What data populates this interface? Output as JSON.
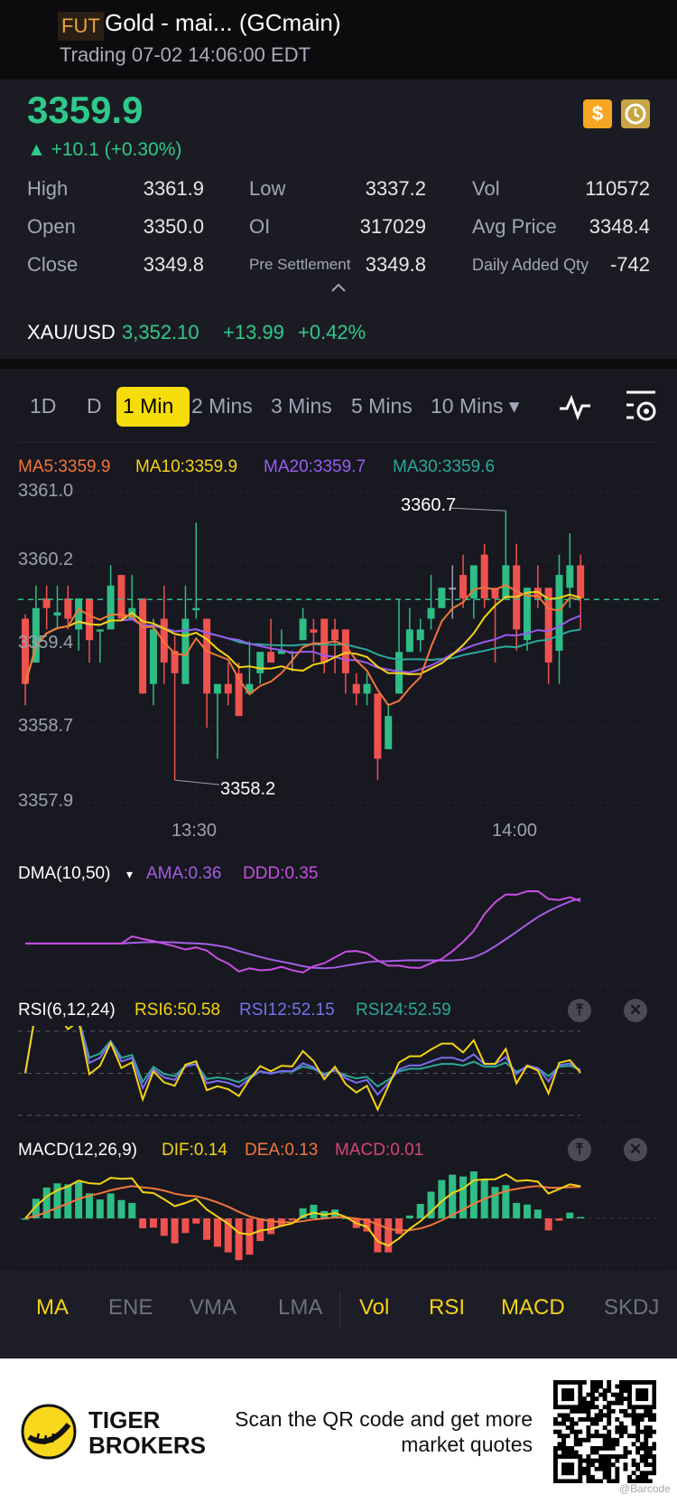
{
  "header": {
    "badge": "FUT",
    "title": "Gold - mai... (GCmain)",
    "status": "Trading 07-02 14:06:00 EDT"
  },
  "quote": {
    "last": "3359.9",
    "change": "▲ +10.1 (+0.30%)",
    "icons": [
      "dollar-icon",
      "history-clock-icon"
    ],
    "stats": [
      {
        "label": "High",
        "value": "3361.9"
      },
      {
        "label": "Low",
        "value": "3337.2"
      },
      {
        "label": "Vol",
        "value": "110572"
      },
      {
        "label": "Open",
        "value": "3350.0"
      },
      {
        "label": "OI",
        "value": "317029"
      },
      {
        "label": "Avg Price",
        "value": "3348.4"
      },
      {
        "label": "Close",
        "value": "3349.8"
      },
      {
        "label": "Pre Settlement",
        "value": "3349.8"
      },
      {
        "label": "Daily Added Qty",
        "value": "-742"
      }
    ],
    "related": {
      "symbol": "XAU/USD",
      "price": "3,352.10",
      "change": "+13.99",
      "pct": "+0.42%"
    }
  },
  "tabs": {
    "items": [
      "1D",
      "D",
      "1 Min",
      "2 Mins",
      "3 Mins",
      "5 Mins",
      "10 Mins ▾"
    ],
    "active": "1 Min"
  },
  "colors": {
    "up": "#2ebd85",
    "down": "#f0524f",
    "accent": "#f5dc0b",
    "ma5": "#f2763a",
    "ma10": "#f5d214",
    "ma20": "#9a5cf0",
    "ma30": "#2aa99a"
  },
  "legend": {
    "ma5": "MA5:3359.9",
    "ma10": "MA10:3359.9",
    "ma20": "MA20:3359.7",
    "ma30": "MA30:3359.6",
    "dma": "DMA(10,50)",
    "dma_caret": "▾",
    "ama": "AMA:0.36",
    "ddd": "DDD:0.35",
    "rsi": "RSI(6,12,24)",
    "rsi6": "RSI6:50.58",
    "rsi12": "RSI12:52.15",
    "rsi24": "RSI24:52.59",
    "macd": "MACD(12,26,9)",
    "dif": "DIF:0.14",
    "dea": "DEA:0.13",
    "macdv": "MACD:0.01"
  },
  "chart_data": {
    "type": "candlestick",
    "y_tick_labels": [
      "3361.0",
      "3360.2",
      "3359.4",
      "3358.7",
      "3357.9"
    ],
    "x_tick_labels": [
      "13:30",
      "14:00"
    ],
    "ylim": [
      3358.0,
      3360.9
    ],
    "high_label": "3360.7",
    "low_label": "3358.2",
    "last_price_line": 3359.9,
    "ohlc": [
      [
        3359.72,
        3359.76,
        3358.91,
        3359.11
      ],
      [
        3359.31,
        3360.03,
        3359.31,
        3359.82
      ],
      [
        3359.91,
        3360.03,
        3359.62,
        3359.82
      ],
      [
        3359.75,
        3360.03,
        3359.62,
        3359.78
      ],
      [
        3359.91,
        3360.03,
        3359.62,
        3359.72
      ],
      [
        3359.62,
        3359.91,
        3359.42,
        3359.91
      ],
      [
        3359.91,
        3359.91,
        3359.31,
        3359.52
      ],
      [
        3359.6,
        3359.62,
        3359.31,
        3359.62
      ],
      [
        3359.62,
        3360.22,
        3359.62,
        3360.03
      ],
      [
        3360.13,
        3360.13,
        3359.72,
        3359.72
      ],
      [
        3359.72,
        3360.13,
        3359.72,
        3359.82
      ],
      [
        3359.91,
        3359.91,
        3359.02,
        3359.02
      ],
      [
        3359.11,
        3359.72,
        3358.91,
        3359.62
      ],
      [
        3359.72,
        3360.03,
        3359.11,
        3359.31
      ],
      [
        3359.42,
        3359.56,
        3358.21,
        3359.21
      ],
      [
        3359.11,
        3360.03,
        3359.11,
        3359.72
      ],
      [
        3359.8,
        3360.62,
        3359.72,
        3359.82
      ],
      [
        3359.72,
        3359.72,
        3358.7,
        3359.02
      ],
      [
        3359.02,
        3359.11,
        3358.41,
        3359.11
      ],
      [
        3359.11,
        3359.31,
        3358.91,
        3359.02
      ],
      [
        3359.21,
        3359.31,
        3358.81,
        3358.81
      ],
      [
        3359.02,
        3359.51,
        3359.02,
        3359.11
      ],
      [
        3359.21,
        3359.41,
        3359.11,
        3359.41
      ],
      [
        3359.41,
        3359.72,
        3359.31,
        3359.31
      ],
      [
        3359.39,
        3359.62,
        3359.39,
        3359.42
      ],
      [
        3359.41,
        3359.42,
        3359.23,
        3359.41
      ],
      [
        3359.52,
        3359.82,
        3359.52,
        3359.72
      ],
      [
        3359.62,
        3359.72,
        3359.31,
        3359.59
      ],
      [
        3359.72,
        3359.72,
        3359.21,
        3359.31
      ],
      [
        3359.62,
        3359.72,
        3359.21,
        3359.52
      ],
      [
        3359.62,
        3359.62,
        3359.02,
        3359.21
      ],
      [
        3359.11,
        3359.21,
        3358.91,
        3359.02
      ],
      [
        3359.02,
        3359.21,
        3358.91,
        3359.11
      ],
      [
        3359.02,
        3359.02,
        3358.21,
        3358.41
      ],
      [
        3358.5,
        3358.91,
        3358.5,
        3358.81
      ],
      [
        3359.02,
        3359.91,
        3359.02,
        3359.41
      ],
      [
        3359.41,
        3359.82,
        3359.41,
        3359.62
      ],
      [
        3359.52,
        3359.72,
        3359.41,
        3359.62
      ],
      [
        3359.72,
        3360.13,
        3359.62,
        3359.82
      ],
      [
        3359.82,
        3360.01,
        3359.82,
        3360.01
      ],
      [
        3360.01,
        3360.22,
        3359.72,
        3360.01
      ],
      [
        3360.13,
        3360.32,
        3359.82,
        3359.91
      ],
      [
        3359.91,
        3360.22,
        3359.72,
        3360.22
      ],
      [
        3360.32,
        3360.42,
        3359.82,
        3359.91
      ],
      [
        3360.01,
        3360.01,
        3359.31,
        3359.91
      ],
      [
        3359.91,
        3360.73,
        3359.91,
        3360.22
      ],
      [
        3360.22,
        3360.42,
        3359.42,
        3359.62
      ],
      [
        3359.52,
        3360.01,
        3359.42,
        3360.01
      ],
      [
        3360.01,
        3360.22,
        3359.82,
        3359.91
      ],
      [
        3360.01,
        3360.01,
        3359.11,
        3359.31
      ],
      [
        3359.42,
        3360.32,
        3359.11,
        3360.13
      ],
      [
        3360.01,
        3360.52,
        3359.82,
        3360.22
      ],
      [
        3360.22,
        3360.32,
        3359.62,
        3359.91
      ]
    ]
  },
  "indicator_bar": {
    "items": [
      {
        "label": "MA",
        "active": true
      },
      {
        "label": "ENE",
        "active": false
      },
      {
        "label": "VMA",
        "active": false
      },
      {
        "label": "LMA",
        "active": false
      },
      {
        "label": "Vol",
        "active": true
      },
      {
        "label": "RSI",
        "active": true
      },
      {
        "label": "MACD",
        "active": true
      },
      {
        "label": "SKDJ",
        "active": false
      }
    ]
  },
  "footer": {
    "brand_line1": "TIGER",
    "brand_line2": "BROKERS",
    "cta_line1": "Scan the QR code and get more",
    "cta_line2": "market quotes",
    "watermark": "@Barcode"
  }
}
